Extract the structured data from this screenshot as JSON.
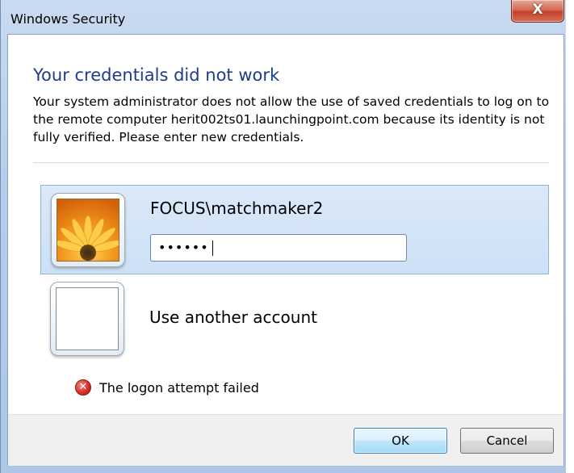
{
  "window": {
    "title": "Windows Security",
    "close_glyph": "X"
  },
  "dialog": {
    "heading": "Your credentials did not work",
    "message": "Your system administrator does not allow the use of saved credentials to log on to the remote computer herit002ts01.launchingpoint.com because its identity is not fully verified. Please enter new credentials."
  },
  "accounts": [
    {
      "username": "FOCUS\\matchmaker2",
      "password_masked": "••••••",
      "selected": true,
      "avatar_icon": "orange-flower-icon"
    },
    {
      "label": "Use another account",
      "selected": false,
      "avatar_icon": "blank-avatar-icon"
    }
  ],
  "error": {
    "icon": "error-icon",
    "icon_glyph": "✕",
    "text": "The logon attempt failed"
  },
  "buttons": {
    "ok": "OK",
    "cancel": "Cancel"
  },
  "colors": {
    "heading": "#1e3c8c",
    "selection": "#cde0f6",
    "error": "#d9302a"
  }
}
